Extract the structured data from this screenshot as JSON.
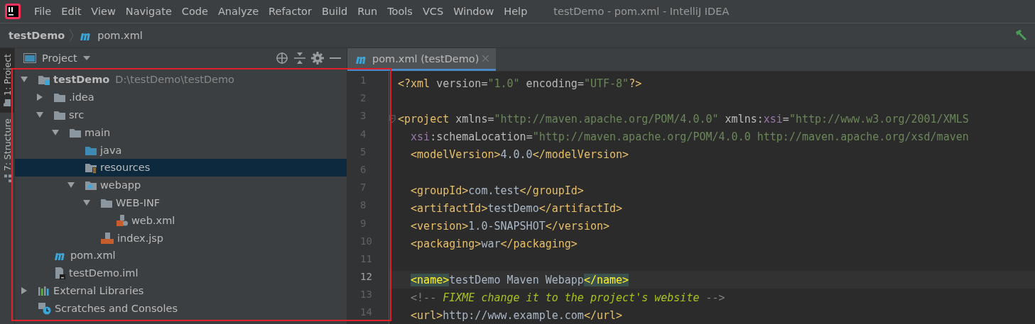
{
  "window": {
    "title": "testDemo - pom.xml - IntelliJ IDEA"
  },
  "menu": [
    "File",
    "Edit",
    "View",
    "Navigate",
    "Code",
    "Analyze",
    "Refactor",
    "Build",
    "Run",
    "Tools",
    "VCS",
    "Window",
    "Help"
  ],
  "breadcrumb": [
    {
      "label": "testDemo",
      "kind": "project"
    },
    {
      "label": "pom.xml",
      "kind": "maven"
    }
  ],
  "tool_tabs": [
    {
      "label": "1: Project",
      "selected": true
    },
    {
      "label": "7: Structure",
      "selected": false
    }
  ],
  "project_panel": {
    "title": "Project",
    "tree": [
      {
        "label": "testDemo",
        "path": "D:\\testDemo\\testDemo",
        "kind": "module",
        "expanded": true,
        "selected": false,
        "children": [
          {
            "label": ".idea",
            "kind": "folder",
            "expanded": false,
            "selected": false
          },
          {
            "label": "src",
            "kind": "folder",
            "expanded": true,
            "selected": false,
            "children": [
              {
                "label": "main",
                "kind": "folder",
                "expanded": true,
                "selected": false,
                "children": [
                  {
                    "label": "java",
                    "kind": "source",
                    "selected": false
                  },
                  {
                    "label": "resources",
                    "kind": "resources",
                    "selected": true
                  },
                  {
                    "label": "webapp",
                    "kind": "web",
                    "expanded": true,
                    "selected": false,
                    "children": [
                      {
                        "label": "WEB-INF",
                        "kind": "folder",
                        "expanded": true,
                        "selected": false,
                        "children": [
                          {
                            "label": "web.xml",
                            "kind": "webxml",
                            "selected": false
                          }
                        ]
                      },
                      {
                        "label": "index.jsp",
                        "kind": "jsp",
                        "selected": false
                      }
                    ]
                  }
                ]
              }
            ]
          },
          {
            "label": "pom.xml",
            "kind": "maven",
            "selected": false
          },
          {
            "label": "testDemo.iml",
            "kind": "iml",
            "selected": false
          }
        ]
      },
      {
        "label": "External Libraries",
        "kind": "libraries",
        "expanded": false,
        "selected": false
      },
      {
        "label": "Scratches and Consoles",
        "kind": "scratches",
        "selected": false
      }
    ]
  },
  "editor": {
    "tabs": [
      {
        "label": "pom.xml (testDemo)",
        "selected": true
      }
    ],
    "lines": [
      {
        "number": "1",
        "current": false,
        "fold": false,
        "tokens": [
          {
            "kind": "tag",
            "text": "<?xml "
          },
          {
            "kind": "attr",
            "text": "version"
          },
          {
            "kind": "punct",
            "text": "="
          },
          {
            "kind": "value",
            "text": "\"1.0\""
          },
          {
            "kind": "attr",
            "text": " encoding"
          },
          {
            "kind": "punct",
            "text": "="
          },
          {
            "kind": "value",
            "text": "\"UTF-8\""
          },
          {
            "kind": "tag",
            "text": "?>"
          }
        ]
      },
      {
        "number": "2",
        "current": false,
        "fold": false
      },
      {
        "number": "3",
        "current": false,
        "fold": true,
        "tokens": [
          {
            "kind": "tag",
            "text": "<project "
          },
          {
            "kind": "attr",
            "text": "xmlns"
          },
          {
            "kind": "punct",
            "text": "="
          },
          {
            "kind": "value",
            "text": "\"http://maven.apache.org/POM/4.0.0\""
          },
          {
            "kind": "attr",
            "text": " xmlns:"
          },
          {
            "kind": "ns",
            "text": "xsi"
          },
          {
            "kind": "punct",
            "text": "="
          },
          {
            "kind": "value",
            "text": "\"http://www.w3.org/2001/XMLS"
          }
        ]
      },
      {
        "number": "4",
        "current": false,
        "fold": false,
        "tokens": [
          {
            "kind": "ns",
            "text": "  xsi"
          },
          {
            "kind": "attr",
            "text": ":schemaLocation"
          },
          {
            "kind": "punct",
            "text": "="
          },
          {
            "kind": "value",
            "text": "\"http://maven.apache.org/POM/4.0.0 http://maven.apache.org/xsd/maven"
          }
        ]
      },
      {
        "number": "5",
        "current": false,
        "fold": false,
        "tokens": [
          {
            "kind": "tag",
            "text": "  <modelVersion>"
          },
          {
            "kind": "text",
            "text": "4.0.0"
          },
          {
            "kind": "tag",
            "text": "</modelVersion>"
          }
        ]
      },
      {
        "number": "6",
        "current": false,
        "fold": false
      },
      {
        "number": "7",
        "current": false,
        "fold": false,
        "tokens": [
          {
            "kind": "tag",
            "text": "  <groupId>"
          },
          {
            "kind": "text",
            "text": "com.test"
          },
          {
            "kind": "tag",
            "text": "</groupId>"
          }
        ]
      },
      {
        "number": "8",
        "current": false,
        "fold": false,
        "tokens": [
          {
            "kind": "tag",
            "text": "  <artifactId>"
          },
          {
            "kind": "text",
            "text": "testDemo"
          },
          {
            "kind": "tag",
            "text": "</artifactId>"
          }
        ]
      },
      {
        "number": "9",
        "current": false,
        "fold": false,
        "tokens": [
          {
            "kind": "tag",
            "text": "  <version>"
          },
          {
            "kind": "text",
            "text": "1.0-SNAPSHOT"
          },
          {
            "kind": "tag",
            "text": "</version>"
          }
        ]
      },
      {
        "number": "10",
        "current": false,
        "fold": false,
        "tokens": [
          {
            "kind": "tag",
            "text": "  <packaging>"
          },
          {
            "kind": "text",
            "text": "war"
          },
          {
            "kind": "tag",
            "text": "</packaging>"
          }
        ]
      },
      {
        "number": "11",
        "current": false,
        "fold": false
      },
      {
        "number": "12",
        "current": true,
        "fold": false,
        "tokens": [
          {
            "kind": "match",
            "text": "<name>"
          },
          {
            "kind": "text",
            "text": "testDemo Maven Webapp"
          },
          {
            "kind": "match",
            "text": "</name>"
          }
        ]
      },
      {
        "number": "13",
        "current": false,
        "fold": false,
        "tokens": [
          {
            "kind": "comment",
            "text": "  <!-- "
          },
          {
            "kind": "todo",
            "text": "FIXME change it to the project's website"
          },
          {
            "kind": "comment",
            "text": " -->"
          }
        ]
      },
      {
        "number": "14",
        "current": false,
        "fold": false,
        "tokens": [
          {
            "kind": "tag",
            "text": "  <url>"
          },
          {
            "kind": "text",
            "text": "http://www.example.com"
          },
          {
            "kind": "tag",
            "text": "</url>"
          }
        ]
      }
    ]
  }
}
